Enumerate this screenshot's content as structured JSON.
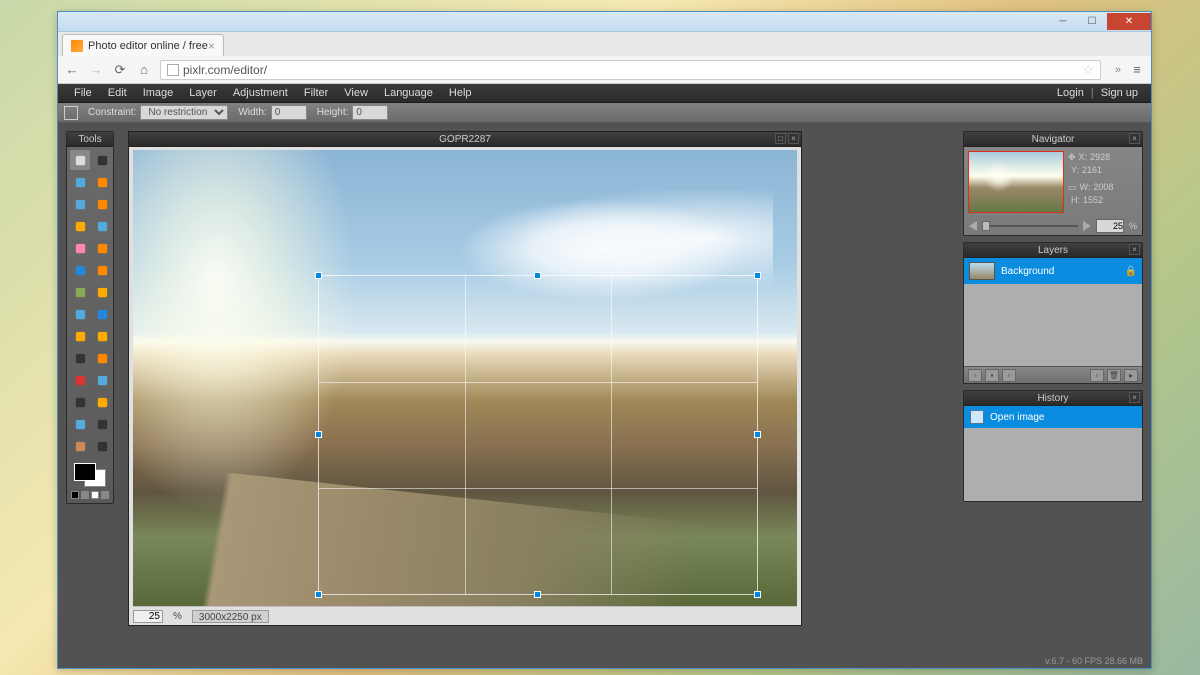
{
  "window": {
    "title": "Photo editor online / free"
  },
  "browser": {
    "tab_title": "Photo editor online / free",
    "url": "pixlr.com/editor/"
  },
  "menu": [
    "File",
    "Edit",
    "Image",
    "Layer",
    "Adjustment",
    "Filter",
    "View",
    "Language",
    "Help"
  ],
  "auth": {
    "login": "Login",
    "signup": "Sign up"
  },
  "optbar": {
    "constraint_label": "Constraint:",
    "constraint_value": "No restriction",
    "width_label": "Width:",
    "width_value": "0",
    "height_label": "Height:",
    "height_value": "0"
  },
  "tools_title": "Tools",
  "doc": {
    "title": "GOPR2287",
    "zoom": "25",
    "zoom_unit": "%",
    "dimensions": "3000x2250 px"
  },
  "navigator": {
    "title": "Navigator",
    "x_label": "X:",
    "x": "2928",
    "y_label": "Y:",
    "y": "2161",
    "w_label": "W:",
    "w": "2008",
    "h_label": "H:",
    "h": "1552",
    "zoom": "25",
    "zoom_unit": "%"
  },
  "layers": {
    "title": "Layers",
    "items": [
      {
        "name": "Background",
        "locked": true
      }
    ]
  },
  "history": {
    "title": "History",
    "items": [
      {
        "name": "Open image"
      }
    ]
  },
  "status": "v.6.7 - 60 FPS 28.66 MB",
  "tool_names": [
    "crop",
    "move",
    "marquee",
    "lasso",
    "wand",
    "crop2",
    "pencil",
    "brush",
    "eraser",
    "erase2",
    "fill",
    "gradient",
    "clone",
    "stamp",
    "blur",
    "sharpen",
    "smudge",
    "sponge",
    "dodge",
    "burn",
    "redeye",
    "spot",
    "bloat",
    "pinch",
    "picker",
    "type",
    "hand",
    "zoom"
  ]
}
